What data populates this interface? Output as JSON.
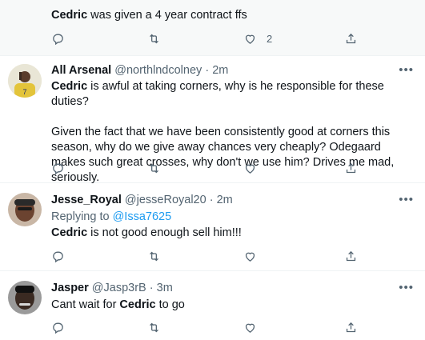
{
  "tweets": [
    {
      "body_name": "Cedric",
      "body_rest": " was given a 4 year contract ffs",
      "like_count": "2"
    },
    {
      "name": "All Arsenal",
      "handle": "@northlndcolney",
      "dot": "·",
      "time": "2m",
      "body_name": "Cedric",
      "body_rest": " is awful at taking corners, why is he responsible for these duties?",
      "body_para2": "Given the fact that we have been consistently good at corners this season, why do we give away chances very cheaply? Odegaard makes such great crosses, why don't we use him? Drives me mad, seriously."
    },
    {
      "name": "Jesse_Royal",
      "handle": "@jesseRoyal20",
      "dot": "·",
      "time": "2m",
      "replying_prefix": "Replying to ",
      "replying_handle": "@Issa7625",
      "body_name": "Cedric",
      "body_rest": " is not good enough sell him!!!"
    },
    {
      "name": "Jasper",
      "handle": "@Jasp3rB",
      "dot": "·",
      "time": "3m",
      "body_before": "Cant wait for ",
      "body_name": "Cedric",
      "body_after": " to go"
    }
  ],
  "more_label": "•••",
  "colors": {
    "muted": "#536471",
    "link": "#1d9bf0",
    "divider": "#eff3f4"
  },
  "icons": [
    "reply-icon",
    "retweet-icon",
    "like-icon",
    "share-icon",
    "more-icon"
  ]
}
